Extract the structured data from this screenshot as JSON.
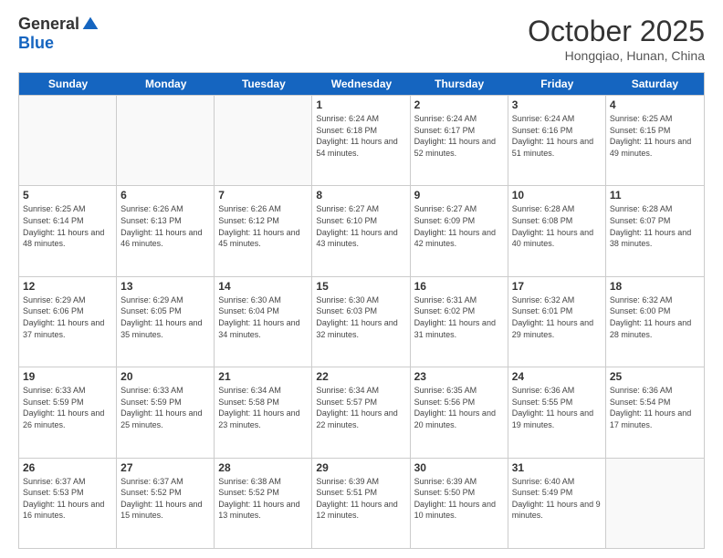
{
  "logo": {
    "general": "General",
    "blue": "Blue"
  },
  "title": "October 2025",
  "subtitle": "Hongqiao, Hunan, China",
  "days_of_week": [
    "Sunday",
    "Monday",
    "Tuesday",
    "Wednesday",
    "Thursday",
    "Friday",
    "Saturday"
  ],
  "weeks": [
    [
      {
        "day": "",
        "sunrise": "",
        "sunset": "",
        "daylight": ""
      },
      {
        "day": "",
        "sunrise": "",
        "sunset": "",
        "daylight": ""
      },
      {
        "day": "",
        "sunrise": "",
        "sunset": "",
        "daylight": ""
      },
      {
        "day": "1",
        "sunrise": "Sunrise: 6:24 AM",
        "sunset": "Sunset: 6:18 PM",
        "daylight": "Daylight: 11 hours and 54 minutes."
      },
      {
        "day": "2",
        "sunrise": "Sunrise: 6:24 AM",
        "sunset": "Sunset: 6:17 PM",
        "daylight": "Daylight: 11 hours and 52 minutes."
      },
      {
        "day": "3",
        "sunrise": "Sunrise: 6:24 AM",
        "sunset": "Sunset: 6:16 PM",
        "daylight": "Daylight: 11 hours and 51 minutes."
      },
      {
        "day": "4",
        "sunrise": "Sunrise: 6:25 AM",
        "sunset": "Sunset: 6:15 PM",
        "daylight": "Daylight: 11 hours and 49 minutes."
      }
    ],
    [
      {
        "day": "5",
        "sunrise": "Sunrise: 6:25 AM",
        "sunset": "Sunset: 6:14 PM",
        "daylight": "Daylight: 11 hours and 48 minutes."
      },
      {
        "day": "6",
        "sunrise": "Sunrise: 6:26 AM",
        "sunset": "Sunset: 6:13 PM",
        "daylight": "Daylight: 11 hours and 46 minutes."
      },
      {
        "day": "7",
        "sunrise": "Sunrise: 6:26 AM",
        "sunset": "Sunset: 6:12 PM",
        "daylight": "Daylight: 11 hours and 45 minutes."
      },
      {
        "day": "8",
        "sunrise": "Sunrise: 6:27 AM",
        "sunset": "Sunset: 6:10 PM",
        "daylight": "Daylight: 11 hours and 43 minutes."
      },
      {
        "day": "9",
        "sunrise": "Sunrise: 6:27 AM",
        "sunset": "Sunset: 6:09 PM",
        "daylight": "Daylight: 11 hours and 42 minutes."
      },
      {
        "day": "10",
        "sunrise": "Sunrise: 6:28 AM",
        "sunset": "Sunset: 6:08 PM",
        "daylight": "Daylight: 11 hours and 40 minutes."
      },
      {
        "day": "11",
        "sunrise": "Sunrise: 6:28 AM",
        "sunset": "Sunset: 6:07 PM",
        "daylight": "Daylight: 11 hours and 38 minutes."
      }
    ],
    [
      {
        "day": "12",
        "sunrise": "Sunrise: 6:29 AM",
        "sunset": "Sunset: 6:06 PM",
        "daylight": "Daylight: 11 hours and 37 minutes."
      },
      {
        "day": "13",
        "sunrise": "Sunrise: 6:29 AM",
        "sunset": "Sunset: 6:05 PM",
        "daylight": "Daylight: 11 hours and 35 minutes."
      },
      {
        "day": "14",
        "sunrise": "Sunrise: 6:30 AM",
        "sunset": "Sunset: 6:04 PM",
        "daylight": "Daylight: 11 hours and 34 minutes."
      },
      {
        "day": "15",
        "sunrise": "Sunrise: 6:30 AM",
        "sunset": "Sunset: 6:03 PM",
        "daylight": "Daylight: 11 hours and 32 minutes."
      },
      {
        "day": "16",
        "sunrise": "Sunrise: 6:31 AM",
        "sunset": "Sunset: 6:02 PM",
        "daylight": "Daylight: 11 hours and 31 minutes."
      },
      {
        "day": "17",
        "sunrise": "Sunrise: 6:32 AM",
        "sunset": "Sunset: 6:01 PM",
        "daylight": "Daylight: 11 hours and 29 minutes."
      },
      {
        "day": "18",
        "sunrise": "Sunrise: 6:32 AM",
        "sunset": "Sunset: 6:00 PM",
        "daylight": "Daylight: 11 hours and 28 minutes."
      }
    ],
    [
      {
        "day": "19",
        "sunrise": "Sunrise: 6:33 AM",
        "sunset": "Sunset: 5:59 PM",
        "daylight": "Daylight: 11 hours and 26 minutes."
      },
      {
        "day": "20",
        "sunrise": "Sunrise: 6:33 AM",
        "sunset": "Sunset: 5:59 PM",
        "daylight": "Daylight: 11 hours and 25 minutes."
      },
      {
        "day": "21",
        "sunrise": "Sunrise: 6:34 AM",
        "sunset": "Sunset: 5:58 PM",
        "daylight": "Daylight: 11 hours and 23 minutes."
      },
      {
        "day": "22",
        "sunrise": "Sunrise: 6:34 AM",
        "sunset": "Sunset: 5:57 PM",
        "daylight": "Daylight: 11 hours and 22 minutes."
      },
      {
        "day": "23",
        "sunrise": "Sunrise: 6:35 AM",
        "sunset": "Sunset: 5:56 PM",
        "daylight": "Daylight: 11 hours and 20 minutes."
      },
      {
        "day": "24",
        "sunrise": "Sunrise: 6:36 AM",
        "sunset": "Sunset: 5:55 PM",
        "daylight": "Daylight: 11 hours and 19 minutes."
      },
      {
        "day": "25",
        "sunrise": "Sunrise: 6:36 AM",
        "sunset": "Sunset: 5:54 PM",
        "daylight": "Daylight: 11 hours and 17 minutes."
      }
    ],
    [
      {
        "day": "26",
        "sunrise": "Sunrise: 6:37 AM",
        "sunset": "Sunset: 5:53 PM",
        "daylight": "Daylight: 11 hours and 16 minutes."
      },
      {
        "day": "27",
        "sunrise": "Sunrise: 6:37 AM",
        "sunset": "Sunset: 5:52 PM",
        "daylight": "Daylight: 11 hours and 15 minutes."
      },
      {
        "day": "28",
        "sunrise": "Sunrise: 6:38 AM",
        "sunset": "Sunset: 5:52 PM",
        "daylight": "Daylight: 11 hours and 13 minutes."
      },
      {
        "day": "29",
        "sunrise": "Sunrise: 6:39 AM",
        "sunset": "Sunset: 5:51 PM",
        "daylight": "Daylight: 11 hours and 12 minutes."
      },
      {
        "day": "30",
        "sunrise": "Sunrise: 6:39 AM",
        "sunset": "Sunset: 5:50 PM",
        "daylight": "Daylight: 11 hours and 10 minutes."
      },
      {
        "day": "31",
        "sunrise": "Sunrise: 6:40 AM",
        "sunset": "Sunset: 5:49 PM",
        "daylight": "Daylight: 11 hours and 9 minutes."
      },
      {
        "day": "",
        "sunrise": "",
        "sunset": "",
        "daylight": ""
      }
    ]
  ]
}
